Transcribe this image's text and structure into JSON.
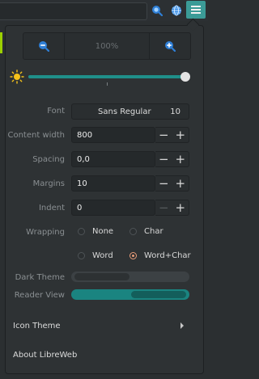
{
  "toolbar": {
    "search_icon": "search-icon",
    "globe_icon": "globe-icon",
    "menu_icon": "hamburger-menu-icon",
    "accent_color": "#3b9b97"
  },
  "zoom": {
    "zoom_out_icon": "zoom-out-icon",
    "zoom_level": "100%",
    "zoom_in_icon": "zoom-in-icon"
  },
  "brightness": {
    "icon": "sun-icon",
    "level": 1.0
  },
  "settings": {
    "font_label": "Font",
    "font_name": "Sans Regular",
    "font_size": "10",
    "content_width_label": "Content width",
    "content_width_value": "800",
    "spacing_label": "Spacing",
    "spacing_value": "0,0",
    "margins_label": "Margins",
    "margins_value": "10",
    "indent_label": "Indent",
    "indent_value": "0",
    "minus": "−",
    "plus": "+"
  },
  "wrapping": {
    "label": "Wrapping",
    "options": [
      "None",
      "Char",
      "Word",
      "Word+Char"
    ],
    "selected": "Word+Char"
  },
  "toggles": {
    "dark_theme_label": "Dark Theme",
    "dark_theme_on": false,
    "reader_view_label": "Reader View",
    "reader_view_on": true
  },
  "menu": {
    "icon_theme_label": "Icon Theme",
    "about_label": "About LibreWeb"
  }
}
